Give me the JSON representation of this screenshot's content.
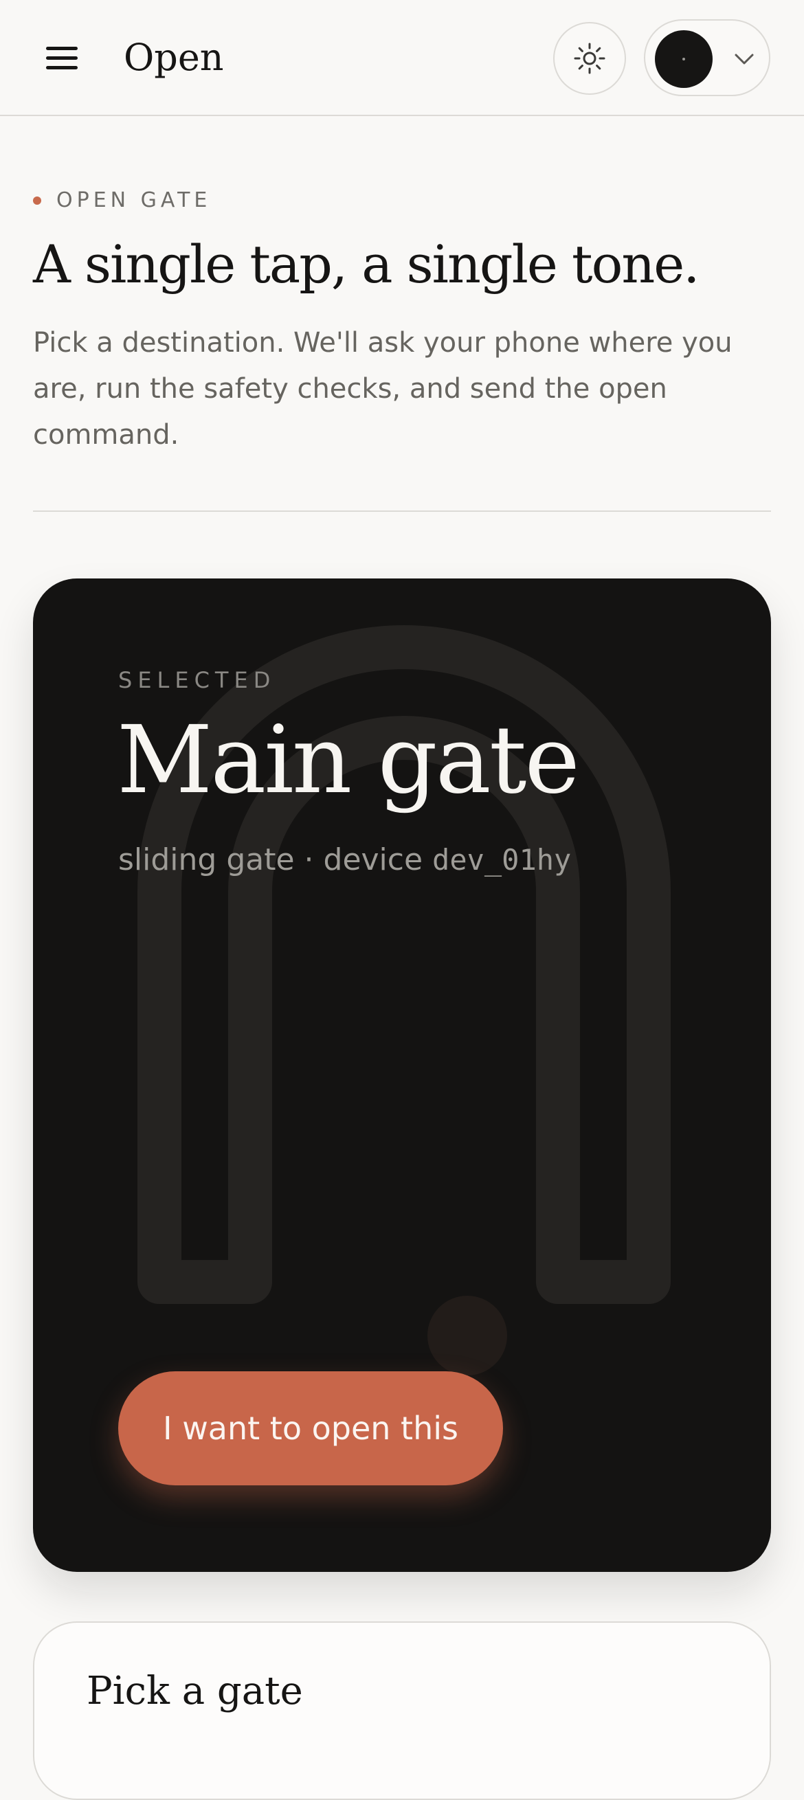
{
  "header": {
    "title": "Open",
    "menu_icon": "hamburger-menu-icon",
    "theme_icon": "sun-icon",
    "account_icon": "chevron-down-icon"
  },
  "intro": {
    "eyebrow": "OPEN GATE",
    "headline": "A single tap, a single tone.",
    "lede": "Pick a destination. We'll ask your phone where you are, run the safety checks, and send the open command."
  },
  "selected": {
    "label": "SELECTED",
    "gate_name": "Main gate",
    "gate_type": "sliding gate",
    "separator": " · ",
    "device_prefix": "device ",
    "device_id": "dev_01hy",
    "action_label": "I want to open this"
  },
  "picker": {
    "title": "Pick a gate"
  },
  "colors": {
    "accent": "#c8664a",
    "card_dark": "#141312",
    "background": "#f9f8f6"
  }
}
